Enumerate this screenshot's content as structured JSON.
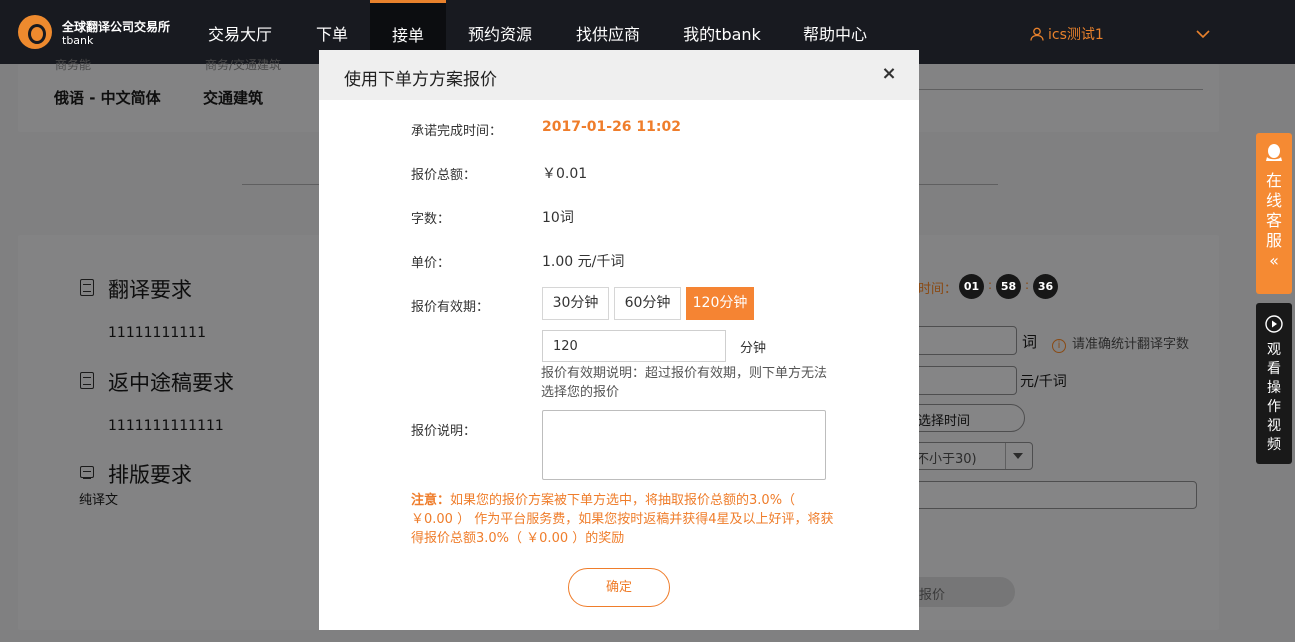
{
  "brand": {
    "name": "全球翻译公司交易所",
    "sub": "tbank"
  },
  "nav": {
    "items": [
      {
        "label": "交易大厅"
      },
      {
        "label": "下单"
      },
      {
        "label": "接单"
      },
      {
        "label": "预约资源"
      },
      {
        "label": "找供应商"
      },
      {
        "label": "我的tbank"
      },
      {
        "label": "帮助中心"
      }
    ],
    "active": "接单",
    "user": "ics测试1"
  },
  "background": {
    "top_faded_1": "商务能",
    "top_faded_2": "商务/交通建筑",
    "language_pair": "俄语 - 中文简体",
    "field": "交通建筑",
    "translation_req_title": "翻译要求",
    "translation_req_value": "11111111111",
    "midway_req_title": "返中途稿要求",
    "midway_req_value": "1111111111111",
    "layout_req_title": "排版要求",
    "layout_req_value": "纯译文",
    "countdown_label": "时间：",
    "countdown": [
      "01",
      "58",
      "36"
    ],
    "word_unit": "词",
    "word_tip": "请准确统计翻译字数",
    "price_unit": "元/千词",
    "select_time_btn": "选择时间",
    "not_less_than": "不小于30)",
    "quote_btn": "报价"
  },
  "side": {
    "service_chars": [
      "在",
      "线",
      "客",
      "服",
      "«"
    ],
    "video_chars": [
      "观",
      "看",
      "操",
      "作",
      "视",
      "频"
    ]
  },
  "modal": {
    "title": "使用下单方方案报价",
    "close": "×",
    "deadline_label": "承诺完成时间：",
    "deadline_value": "2017-01-26 11:02",
    "total_label": "报价总额：",
    "total_value": "￥0.01",
    "words_label": "字数：",
    "words_value": "10词",
    "unit_label": "单价：",
    "unit_value": "1.00 元/千词",
    "validity_label": "报价有效期：",
    "validity_options": [
      "30分钟",
      "60分钟",
      "120分钟"
    ],
    "validity_selected": "120分钟",
    "minutes_value": "120",
    "minutes_unit": "分钟",
    "validity_note": "报价有效期说明：超过报价有效期，则下单方无法选择您的报价",
    "remark_label": "报价说明：",
    "warning_prefix": "注意：",
    "warning_text": "如果您的报价方案被下单方选中，将抽取报价总额的3.0%（ ￥0.00 ） 作为平台服务费，如果您按时返稿并获得4星及以上好评，将获得报价总额3.0%（ ￥0.00 ）的奖励",
    "confirm": "确定"
  }
}
